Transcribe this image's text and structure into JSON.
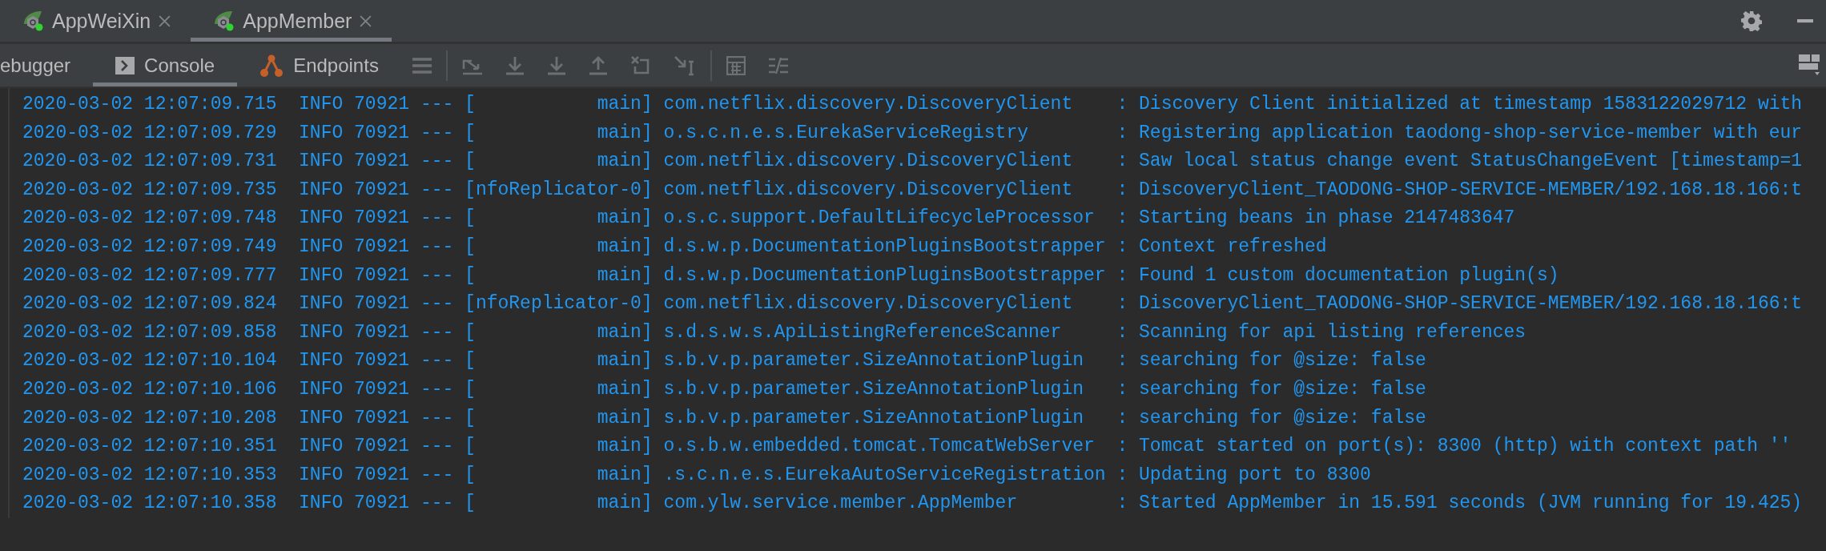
{
  "editor_tabs": [
    {
      "label": "AppWeiXin",
      "selected": false
    },
    {
      "label": "AppMember",
      "selected": true
    }
  ],
  "tool_tabs": [
    {
      "label": "ebugger",
      "selected": false,
      "kind": "plain"
    },
    {
      "label": "Console",
      "selected": true,
      "kind": "console"
    },
    {
      "label": "Endpoints",
      "selected": false,
      "kind": "endpoints"
    }
  ],
  "log_lines": [
    "2020-03-02 12:07:09.715  INFO 70921 --- [           main] com.netflix.discovery.DiscoveryClient    : Discovery Client initialized at timestamp 1583122029712 with",
    "2020-03-02 12:07:09.729  INFO 70921 --- [           main] o.s.c.n.e.s.EurekaServiceRegistry        : Registering application taodong-shop-service-member with eur",
    "2020-03-02 12:07:09.731  INFO 70921 --- [           main] com.netflix.discovery.DiscoveryClient    : Saw local status change event StatusChangeEvent [timestamp=1",
    "2020-03-02 12:07:09.735  INFO 70921 --- [nfoReplicator-0] com.netflix.discovery.DiscoveryClient    : DiscoveryClient_TAODONG-SHOP-SERVICE-MEMBER/192.168.18.166:t",
    "2020-03-02 12:07:09.748  INFO 70921 --- [           main] o.s.c.support.DefaultLifecycleProcessor  : Starting beans in phase 2147483647",
    "2020-03-02 12:07:09.749  INFO 70921 --- [           main] d.s.w.p.DocumentationPluginsBootstrapper : Context refreshed",
    "2020-03-02 12:07:09.777  INFO 70921 --- [           main] d.s.w.p.DocumentationPluginsBootstrapper : Found 1 custom documentation plugin(s)",
    "2020-03-02 12:07:09.824  INFO 70921 --- [nfoReplicator-0] com.netflix.discovery.DiscoveryClient    : DiscoveryClient_TAODONG-SHOP-SERVICE-MEMBER/192.168.18.166:t",
    "2020-03-02 12:07:09.858  INFO 70921 --- [           main] s.d.s.w.s.ApiListingReferenceScanner     : Scanning for api listing references",
    "2020-03-02 12:07:10.104  INFO 70921 --- [           main] s.b.v.p.parameter.SizeAnnotationPlugin   : searching for @size: false",
    "2020-03-02 12:07:10.106  INFO 70921 --- [           main] s.b.v.p.parameter.SizeAnnotationPlugin   : searching for @size: false",
    "2020-03-02 12:07:10.208  INFO 70921 --- [           main] s.b.v.p.parameter.SizeAnnotationPlugin   : searching for @size: false",
    "2020-03-02 12:07:10.351  INFO 70921 --- [           main] o.s.b.w.embedded.tomcat.TomcatWebServer  : Tomcat started on port(s): 8300 (http) with context path ''",
    "2020-03-02 12:07:10.353  INFO 70921 --- [           main] .s.c.n.e.s.EurekaAutoServiceRegistration : Updating port to 8300",
    "2020-03-02 12:07:10.358  INFO 70921 --- [           main] com.ylw.service.member.AppMember         : Started AppMember in 15.591 seconds (JVM running for 19.425)"
  ]
}
